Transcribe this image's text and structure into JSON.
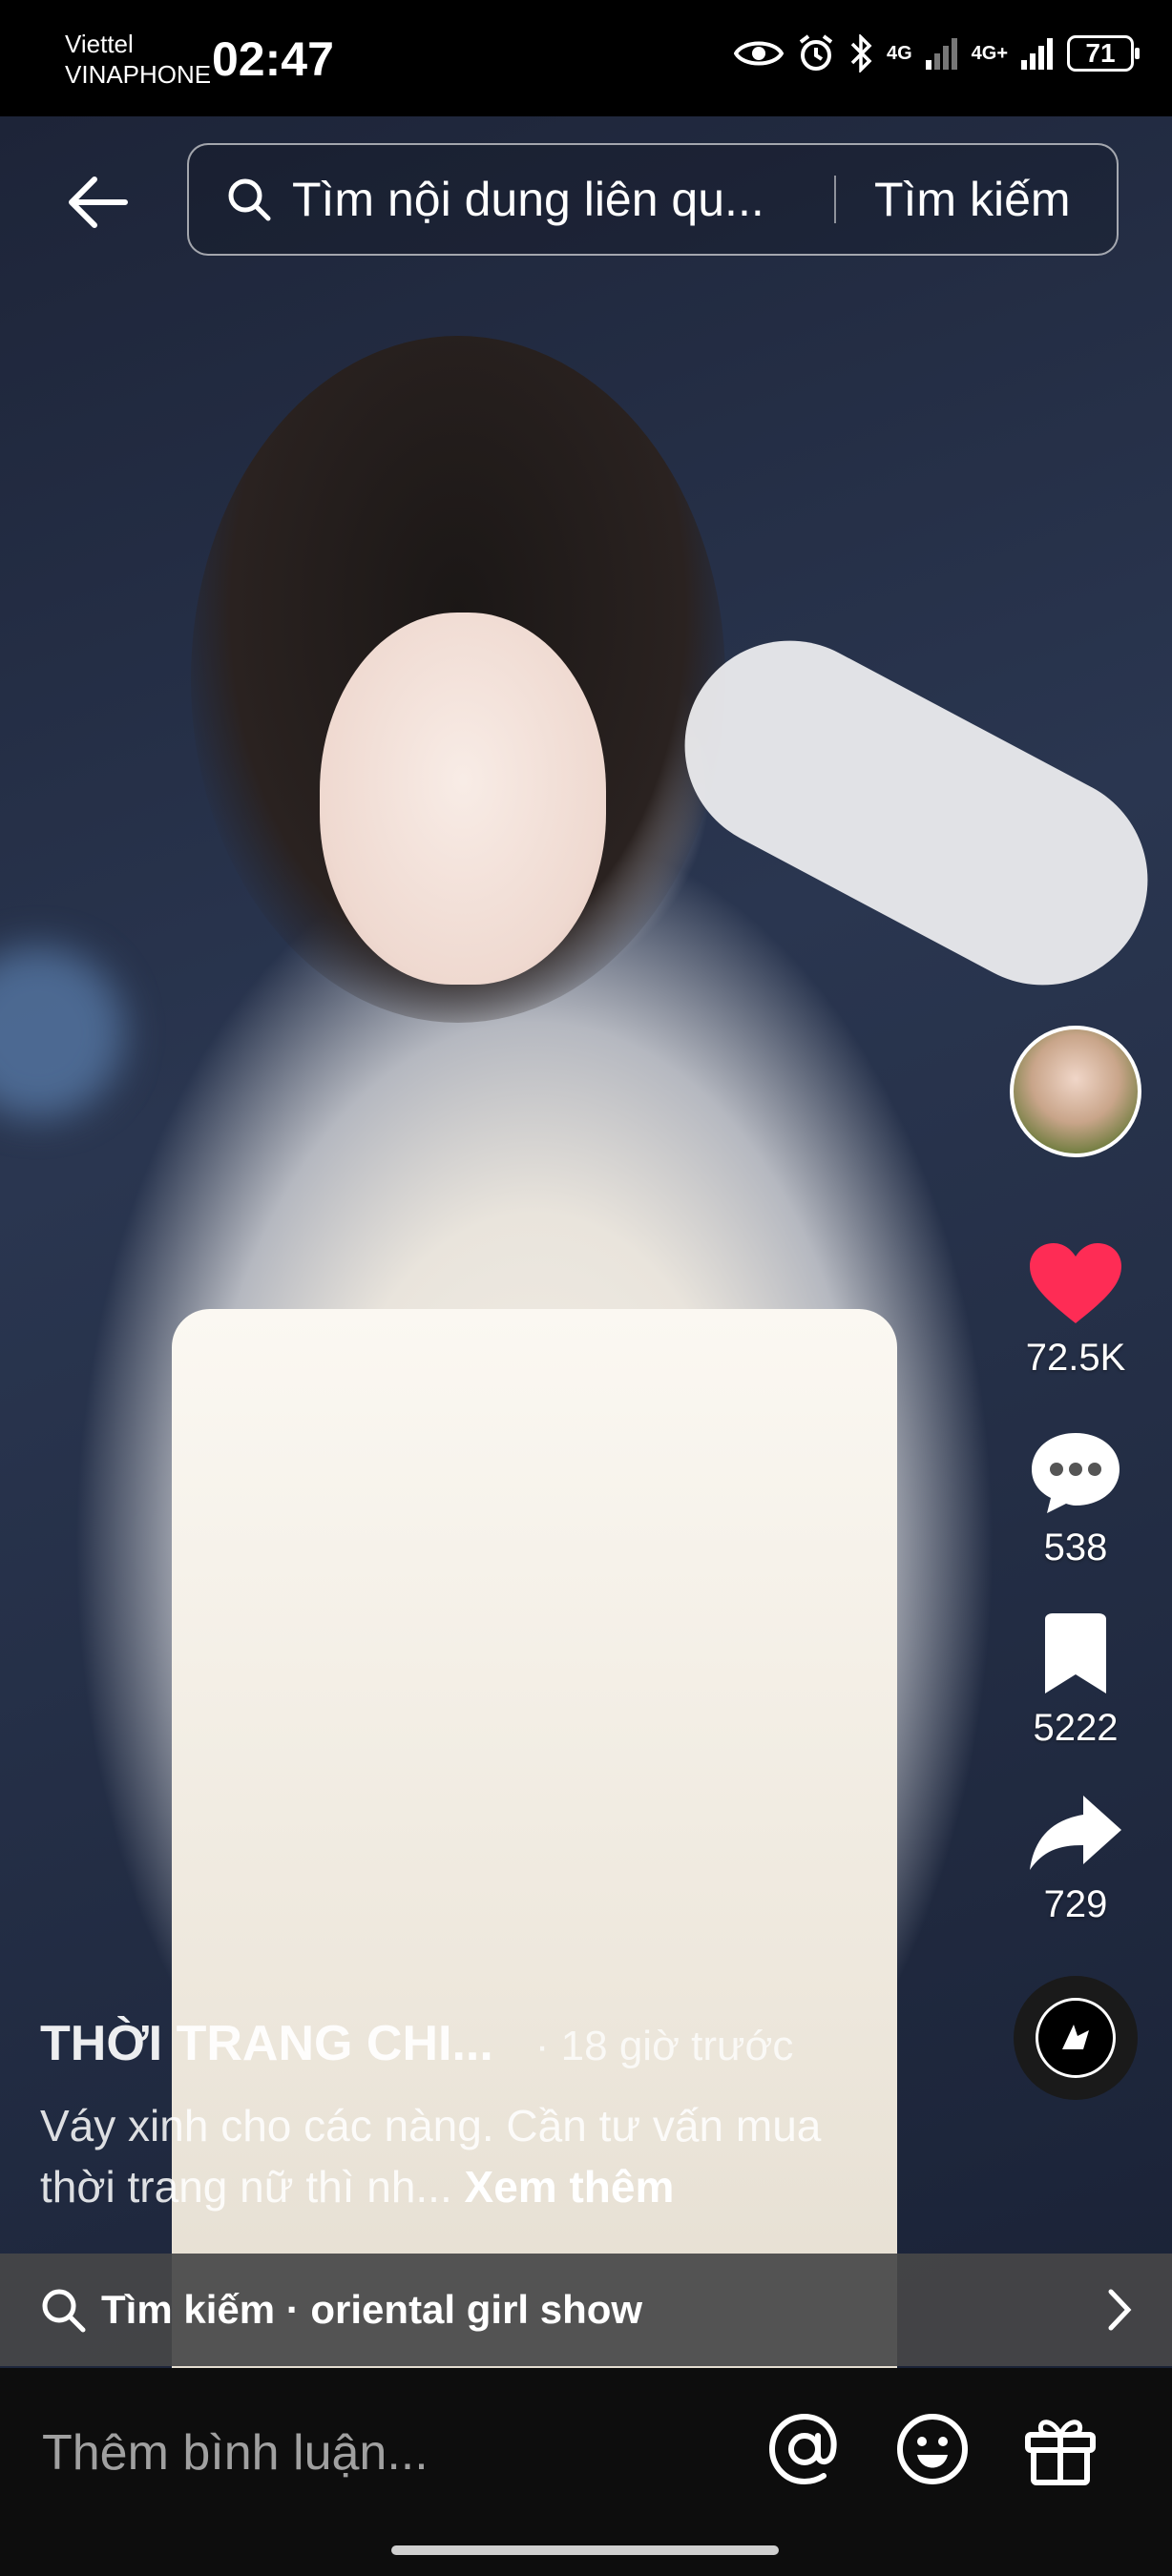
{
  "status_bar": {
    "carrier_1": "Viettel",
    "carrier_2": "VINAPHONE",
    "time": "02:47",
    "network_1": "4G",
    "network_2": "4G+",
    "battery": "71"
  },
  "search": {
    "placeholder": "Tìm nội dung liên qu...",
    "button_label": "Tìm kiếm"
  },
  "actions": {
    "likes": "72.5K",
    "comments": "538",
    "saves": "5222",
    "shares": "729"
  },
  "post": {
    "author": "THỜI TRANG CHI...",
    "time_ago": "· 18 giờ trước",
    "description": "Váy xinh cho các nàng. Cần tư vấn mua thời trang nữ thì nh...",
    "see_more": "Xem thêm"
  },
  "related_search": {
    "text": "Tìm kiếm · oriental girl show"
  },
  "comment_bar": {
    "placeholder": "Thêm bình luận..."
  },
  "colors": {
    "like": "#fe2c55",
    "background": "#000000"
  }
}
